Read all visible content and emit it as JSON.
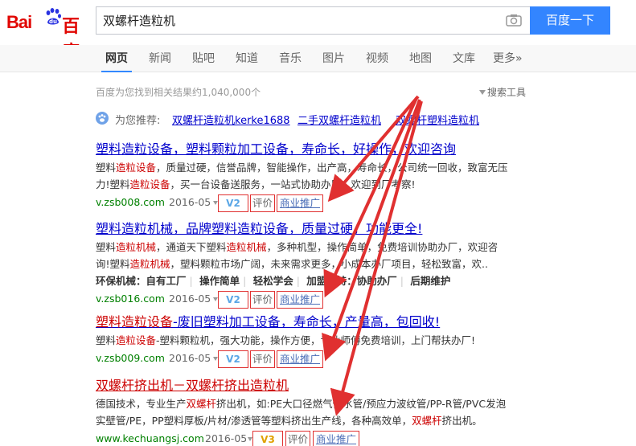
{
  "header": {
    "logo_left": "Bai",
    "logo_right": "百度",
    "logo_du": "du",
    "search_value": "双螺杆造粒机",
    "search_button": "百度一下"
  },
  "nav": {
    "items": [
      "网页",
      "新闻",
      "贴吧",
      "知道",
      "音乐",
      "图片",
      "视频",
      "地图",
      "文库",
      "更多»"
    ]
  },
  "result_count": "百度为您找到相关结果约1,040,000个",
  "tools_label": "搜索工具",
  "recommend": {
    "label": "为您推荐:",
    "links": [
      "双螺杆造粒机kerke1688",
      "二手双螺杆造粒机",
      "双螺杆塑料造粒机"
    ]
  },
  "results": [
    {
      "title": "塑料造粒设备，塑料颗粒加工设备，寿命长，好操作，欢迎咨询",
      "desc1_a": "塑料",
      "desc1_em1": "造粒设备",
      "desc1_b": "，质量过硬，信誉品牌，智能操作，出产高，寿命长，公司统一回收，致富无压",
      "desc2_a": "力!塑料",
      "desc2_em1": "造粒设备",
      "desc2_b": "，买一台设备送服务，一站式协助办厂，欢迎到厂考察!",
      "url": "v.zsb008.com",
      "date": "2016-05",
      "badge": "V2",
      "eval": "评价",
      "promo": "商业推广"
    },
    {
      "title": "塑料造粒机械，品牌塑料造粒设备，质量过硬，功能更全!",
      "desc1_a": "塑料",
      "desc1_em1": "造粒机械",
      "desc1_b": "，通道天下塑料",
      "desc1_em2": "造粒机械",
      "desc1_c": "，多种机型，操作简单，免费培训协助办厂，欢迎咨",
      "desc2_a": "询!塑料",
      "desc2_em1": "造粒机械",
      "desc2_b": "，塑料颗粒市场广阔，未来需求更多，小成本办厂项目，轻松致富，欢..",
      "sublinks": [
        "环保机械：自有工厂",
        "操作简单",
        "轻松学会",
        "加盟支持：协助办厂",
        "后期维护"
      ],
      "url": "v.zsb016.com",
      "date": "2016-05",
      "badge": "V2",
      "eval": "评价",
      "promo": "商业推广"
    },
    {
      "title_a": "塑料造粒设备",
      "title_b": "-废旧塑料加工设备，寿命长，产量高，包回收!",
      "desc1_a": "塑料",
      "desc1_em1": "造粒设备",
      "desc1_b": "-塑料颗粒机，强大功能，操作方便，专业师傅免费培训，上门帮扶办厂!",
      "url": "v.zsb009.com",
      "date": "2016-05",
      "badge": "V2",
      "eval": "评价",
      "promo": "商业推广"
    },
    {
      "title": "双螺杆挤出机－双螺杆挤出造粒机",
      "desc1_a": "德国技术，专业生产",
      "desc1_em1": "双螺杆",
      "desc1_b": "挤出机，如:PE大口径燃气供水管/预应力波纹管/PP-R管/PVC发泡",
      "desc2_a": "实壁管/PE，PP塑料厚板/片材/渗透管等塑料挤出生产线，各种高效单，",
      "desc2_em1": "双螺杆",
      "desc2_b": "挤出机。",
      "url": "www.kechuangsj.com",
      "date": "2016-05",
      "badge": "V3",
      "eval": "评价",
      "promo": "商业推广"
    }
  ],
  "colors": {
    "brand_red": "#e10602",
    "button_blue": "#3385ff",
    "link_blue": "#0000cc",
    "url_green": "#008000",
    "highlight_red": "#c00",
    "annotation_red": "#e03030"
  }
}
